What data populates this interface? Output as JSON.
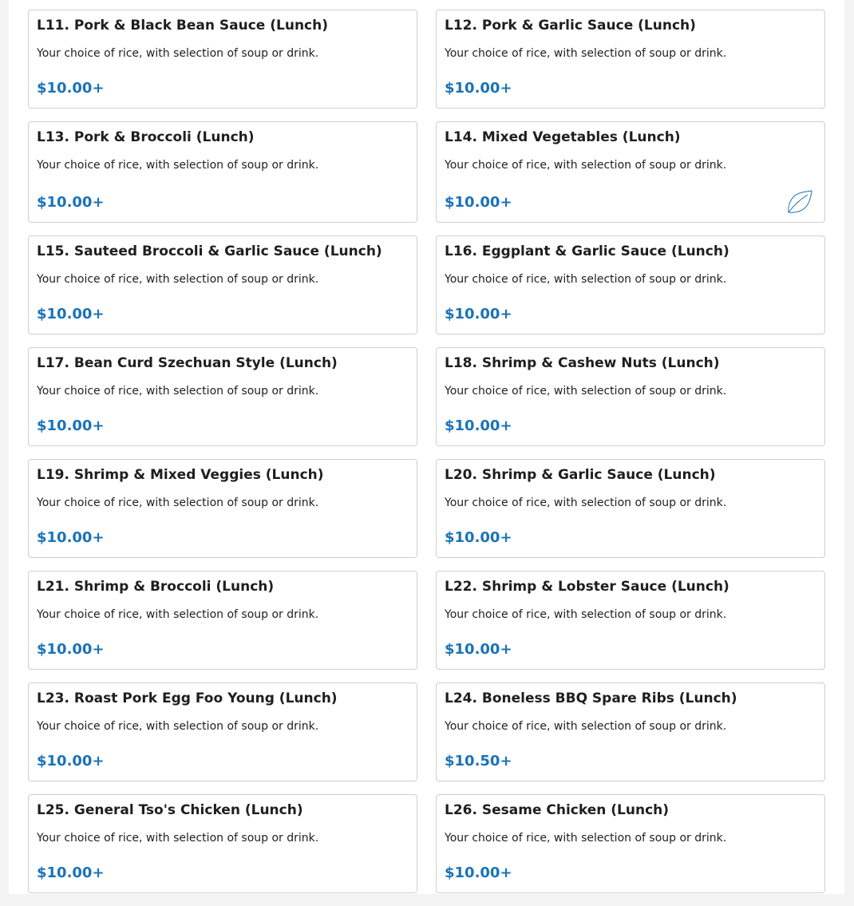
{
  "menu": {
    "items": [
      {
        "title": "L11. Pork & Black Bean Sauce (Lunch)",
        "description": "Your choice of rice, with selection of soup or drink.",
        "price": "$10.00+"
      },
      {
        "title": "L12. Pork & Garlic Sauce (Lunch)",
        "description": "Your choice of rice, with selection of soup or drink.",
        "price": "$10.00+"
      },
      {
        "title": "L13. Pork & Broccoli (Lunch)",
        "description": "Your choice of rice, with selection of soup or drink.",
        "price": "$10.00+"
      },
      {
        "title": "L14. Mixed Vegetables (Lunch)",
        "description": "Your choice of rice, with selection of soup or drink.",
        "price": "$10.00+",
        "icon": "vegetarian-leaf-icon"
      },
      {
        "title": "L15. Sauteed Broccoli & Garlic Sauce (Lunch)",
        "description": "Your choice of rice, with selection of soup or drink.",
        "price": "$10.00+"
      },
      {
        "title": "L16. Eggplant & Garlic Sauce (Lunch)",
        "description": "Your choice of rice, with selection of soup or drink.",
        "price": "$10.00+"
      },
      {
        "title": "L17. Bean Curd Szechuan Style (Lunch)",
        "description": "Your choice of rice, with selection of soup or drink.",
        "price": "$10.00+"
      },
      {
        "title": "L18. Shrimp & Cashew Nuts (Lunch)",
        "description": "Your choice of rice, with selection of soup or drink.",
        "price": "$10.00+"
      },
      {
        "title": "L19. Shrimp & Mixed Veggies (Lunch)",
        "description": "Your choice of rice, with selection of soup or drink.",
        "price": "$10.00+"
      },
      {
        "title": "L20. Shrimp & Garlic Sauce (Lunch)",
        "description": "Your choice of rice, with selection of soup or drink.",
        "price": "$10.00+"
      },
      {
        "title": "L21. Shrimp & Broccoli (Lunch)",
        "description": "Your choice of rice, with selection of soup or drink.",
        "price": "$10.00+"
      },
      {
        "title": "L22. Shrimp & Lobster Sauce (Lunch)",
        "description": "Your choice of rice, with selection of soup or drink.",
        "price": "$10.00+"
      },
      {
        "title": "L23. Roast Pork Egg Foo Young (Lunch)",
        "description": "Your choice of rice, with selection of soup or drink.",
        "price": "$10.00+"
      },
      {
        "title": "L24. Boneless BBQ Spare Ribs (Lunch)",
        "description": "Your choice of rice, with selection of soup or drink.",
        "price": "$10.50+"
      },
      {
        "title": "L25. General Tso's Chicken (Lunch)",
        "description": "Your choice of rice, with selection of soup or drink.",
        "price": "$10.00+"
      },
      {
        "title": "L26. Sesame Chicken (Lunch)",
        "description": "Your choice of rice, with selection of soup or drink.",
        "price": "$10.00+"
      }
    ]
  },
  "colors": {
    "price": "#1a73b8",
    "border": "#cfcfcf",
    "text": "#1e1e1e"
  }
}
